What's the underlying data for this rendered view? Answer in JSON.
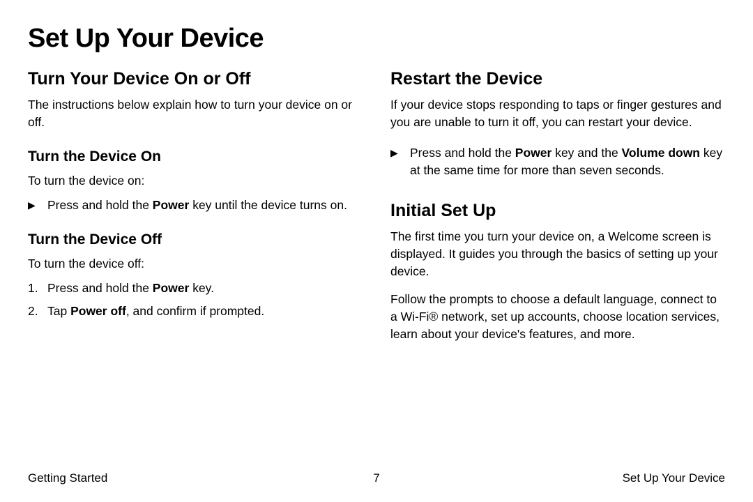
{
  "page_title": "Set Up Your Device",
  "left": {
    "h2": "Turn Your Device On or Off",
    "intro": "The instructions below explain how to turn your device on or off.",
    "on": {
      "h3": "Turn the Device On",
      "lead": "To turn the device on:",
      "bullet_pre": "Press and hold the ",
      "bullet_bold": "Power",
      "bullet_post": " key until the device turns on."
    },
    "off": {
      "h3": "Turn the Device Off",
      "lead": "To turn the device off:",
      "step1_pre": "Press and hold the ",
      "step1_bold": "Power",
      "step1_post": " key.",
      "step2_pre": "Tap ",
      "step2_bold": "Power off",
      "step2_post": ", and confirm if prompted."
    }
  },
  "right": {
    "restart": {
      "h2": "Restart the Device",
      "intro": "If your device stops responding to taps or finger gestures and you are unable to turn it off, you can restart your device.",
      "bullet_pre": "Press and hold the ",
      "bullet_bold1": "Power",
      "bullet_mid": " key and the ",
      "bullet_bold2": "Volume down",
      "bullet_post": " key at the same time for more than seven seconds."
    },
    "initial": {
      "h2": "Initial Set Up",
      "p1": "The first time you turn your device on, a Welcome screen is displayed. It guides you through the basics of setting up your device.",
      "p2": "Follow the prompts to choose a default language, connect to a Wi-Fi® network, set up accounts, choose location services, learn about your device's features, and more."
    }
  },
  "footer": {
    "left": "Getting Started",
    "center": "7",
    "right": "Set Up Your Device"
  },
  "markers": {
    "tri": "▶",
    "n1": "1.",
    "n2": "2."
  }
}
